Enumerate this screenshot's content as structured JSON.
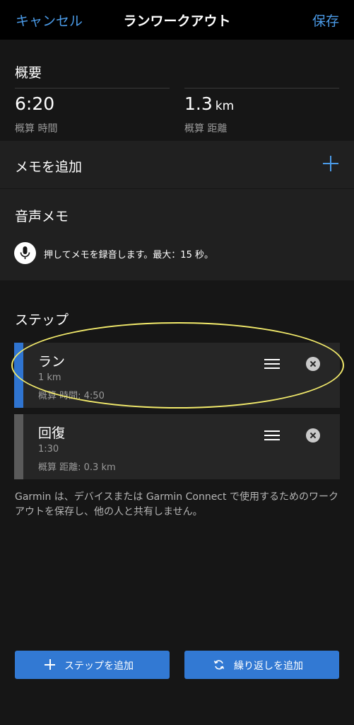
{
  "header": {
    "cancel_label": "キャンセル",
    "title": "ランワークアウト",
    "save_label": "保存"
  },
  "overview": {
    "title": "概要",
    "time_value": "6:20",
    "time_label": "概算 時間",
    "distance_value": "1.3",
    "distance_unit": "km",
    "distance_label": "概算 距離"
  },
  "memo": {
    "add_label": "メモを追加",
    "add_icon": "plus-icon",
    "voice_title": "音声メモ",
    "voice_hint": "押してメモを録音します。最大：15 秒。",
    "mic_icon": "microphone-icon"
  },
  "steps": {
    "title": "ステップ",
    "items": [
      {
        "name": "ラン",
        "detail1": "1 km",
        "detail2": "概算 時間: 4:50",
        "color": "#2f74d0"
      },
      {
        "name": "回復",
        "detail1": "1:30",
        "detail2": "概算 距離: 0.3 km",
        "color": "#5a5a5a"
      }
    ]
  },
  "note": "Garmin は、デバイスまたは Garmin Connect で使用するためのワークアウトを保存し、他の人と共有しません。",
  "actions": {
    "add_step_label": "ステップを追加",
    "add_repeat_label": "繰り返しを追加"
  },
  "colors": {
    "accent": "#4b9be8",
    "button": "#3279d3",
    "highlight": "#f2ea6b",
    "background": "#161616"
  }
}
